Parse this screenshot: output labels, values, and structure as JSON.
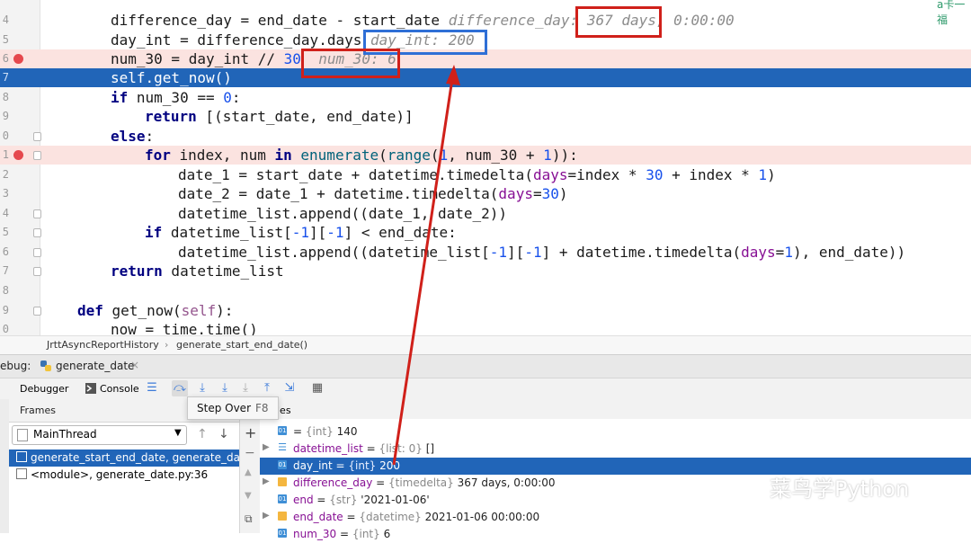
{
  "editor": {
    "lines": [
      {
        "n": "4",
        "parts": []
      },
      {
        "n": "5",
        "parts": []
      },
      {
        "n": "6",
        "parts": []
      },
      {
        "n": "7",
        "parts": []
      },
      {
        "n": "8",
        "parts": []
      },
      {
        "n": "9",
        "parts": []
      },
      {
        "n": "0",
        "parts": []
      },
      {
        "n": "1",
        "parts": []
      },
      {
        "n": "2",
        "parts": []
      },
      {
        "n": "3",
        "parts": []
      },
      {
        "n": "4",
        "parts": []
      },
      {
        "n": "5",
        "parts": []
      },
      {
        "n": "6",
        "parts": []
      },
      {
        "n": "7",
        "parts": []
      },
      {
        "n": "8",
        "parts": []
      },
      {
        "n": "9",
        "parts": []
      },
      {
        "n": "0",
        "parts": []
      },
      {
        "n": "1",
        "parts": []
      }
    ],
    "code": {
      "l1": "difference_day = end_date - start_date",
      "l1_hint_label": "difference_day:",
      "l1_hint_value": "367 days,",
      "l1_hint_rest": "0:00:00",
      "l2": "day_int = difference_day.days",
      "l2_hint": "day_int: 200",
      "l3a": "num_30 = day_int // ",
      "l3b": "30",
      "l3_hint": "num_30: 6",
      "l4": "self.get_now()",
      "l5a": "if",
      "l5b": " num_30 == ",
      "l5c": "0",
      "l5d": ":",
      "l6a": "return",
      "l6b": " [(start_date, end_date)]",
      "l7a": "else",
      "l7b": ":",
      "l8a": "for",
      "l8b": " index, num ",
      "l8c": "in",
      "l8d": " ",
      "l8e": "enumerate",
      "l8f": "(",
      "l8g": "range",
      "l8h": "(",
      "l8i": "1",
      "l8j": ", num_30 + ",
      "l8k": "1",
      "l8l": ")):",
      "l9a": "date_1 = start_date + datetime.timedelta(",
      "l9b": "days",
      "l9c": "=index * ",
      "l9d": "30",
      "l9e": " + index * ",
      "l9f": "1",
      "l9g": ")",
      "l10a": "date_2 = date_1 + datetime.timedelta(",
      "l10b": "days",
      "l10c": "=",
      "l10d": "30",
      "l10e": ")",
      "l11": "datetime_list.append((date_1, date_2))",
      "l12a": "if",
      "l12b": " datetime_list[",
      "l12c": "-1",
      "l12d": "][",
      "l12e": "-1",
      "l12f": "] < end_date:",
      "l13a": "datetime_list.append((datetime_list[",
      "l13b": "-1",
      "l13c": "][",
      "l13d": "-1",
      "l13e": "] + datetime.timedelta(",
      "l13f": "days",
      "l13g": "=",
      "l13h": "1",
      "l13i": "), end_date))",
      "l14a": "return",
      "l14b": " datetime_list",
      "l16a": "def",
      "l16b": " get_now(",
      "l16c": "self",
      "l16d": "):",
      "l17": "now = time.time()"
    }
  },
  "breadcrumb": {
    "class_name": "JrttAsyncReportHistory",
    "separator": "›",
    "method": "generate_start_end_date()"
  },
  "debug": {
    "label": "ebug:",
    "tab": "generate_date",
    "tab_close": "×",
    "debugger_tab": "Debugger",
    "console_tab": "Console",
    "frames_label": "Frames",
    "variables_label": "les",
    "thread": "MainThread",
    "frames": [
      {
        "label": "generate_start_end_date, generate_date",
        "selected": true
      },
      {
        "label": "<module>, generate_date.py:36",
        "selected": false
      }
    ],
    "tooltip_label": "Step Over",
    "tooltip_shortcut": "F8",
    "variables": [
      {
        "name": "",
        "type": "{int}",
        "value": "140",
        "icon": "01",
        "expandable": false
      },
      {
        "name": "datetime_list",
        "type": "{list: 0}",
        "value": "[]",
        "icon": "list",
        "expandable": true
      },
      {
        "name": "day_int",
        "type": "{int}",
        "value": "200",
        "icon": "01",
        "expandable": false
      },
      {
        "name": "difference_day",
        "type": "{timedelta}",
        "value": "367 days, 0:00:00",
        "icon": "obj",
        "expandable": true
      },
      {
        "name": "end",
        "type": "{str}",
        "value": "'2021-01-06'",
        "icon": "01",
        "expandable": false
      },
      {
        "name": "end_date",
        "type": "{datetime}",
        "value": "2021-01-06 00:00:00",
        "icon": "obj",
        "expandable": true
      },
      {
        "name": "num_30",
        "type": "{int}",
        "value": "6",
        "icon": "01",
        "expandable": false
      }
    ]
  },
  "watermark": {
    "text": "菜鸟学Python"
  },
  "corner_text": "a卡一福"
}
